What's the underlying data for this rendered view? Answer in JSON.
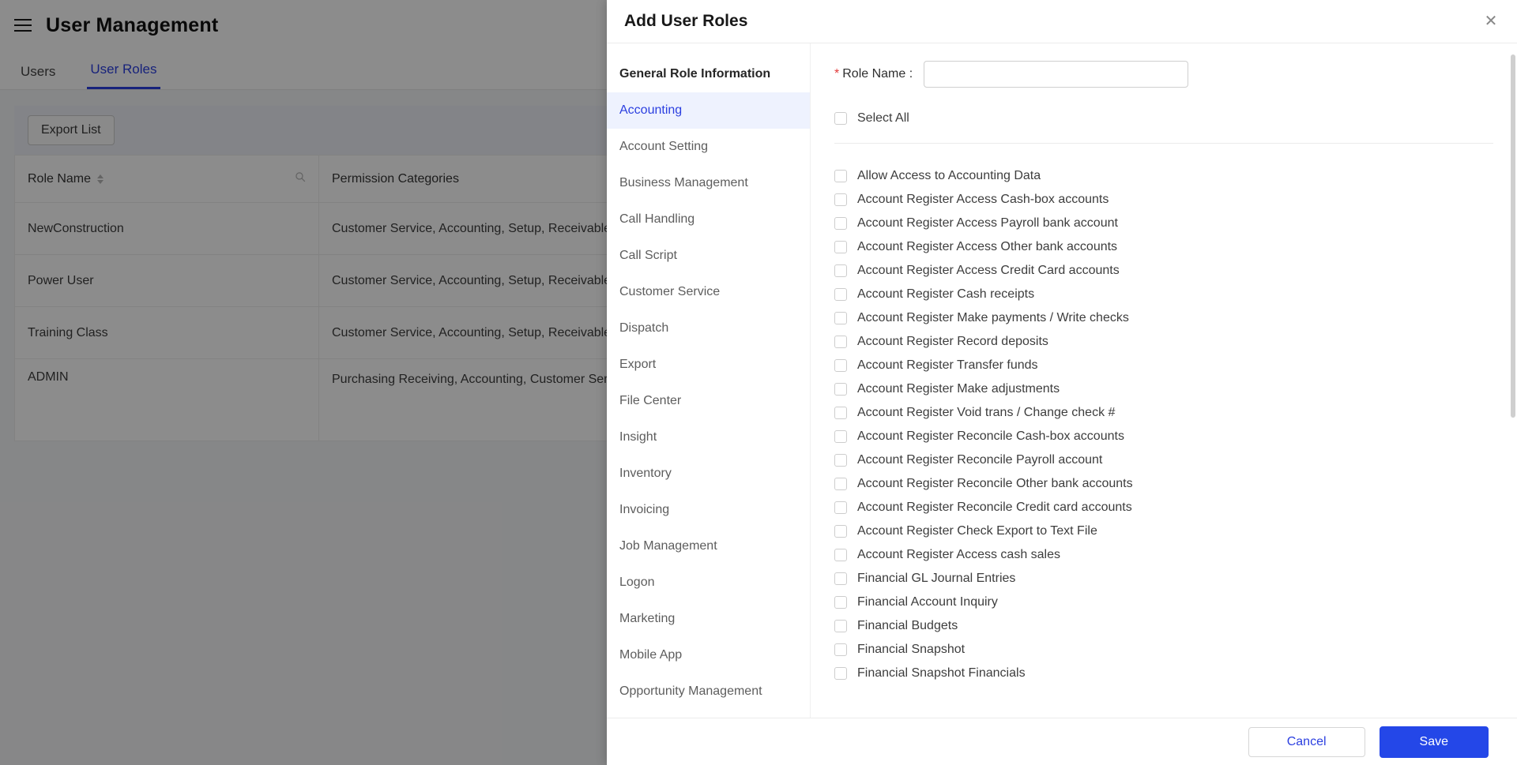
{
  "app": {
    "title": "User Management",
    "menu_icon": "hamburger-icon",
    "tabs": [
      {
        "label": "Users",
        "active": false
      },
      {
        "label": "User Roles",
        "active": true
      }
    ],
    "toolbar": {
      "export_label": "Export List"
    },
    "table": {
      "columns": [
        "Role Name",
        "Permission Categories"
      ],
      "search_icon": "search-icon",
      "rows": [
        {
          "role_name": "NewConstruction",
          "permissions": "Customer Service, Accounting, Setup, Receivables, Purch"
        },
        {
          "role_name": "Power User",
          "permissions": "Customer Service, Accounting, Setup, Receivables, Purch"
        },
        {
          "role_name": "Training Class",
          "permissions": "Customer Service, Accounting, Setup, Receivables, Purch"
        },
        {
          "role_name": "ADMIN",
          "permissions": "Purchasing Receiving, Accounting, Customer Service, Set Logon, Call Handling, Dispatch, Timecard, Product Catalo Management, Account Setting, Insight, Call Script, Job Ma"
        }
      ]
    }
  },
  "modal": {
    "title": "Add User Roles",
    "close_icon": "close-icon",
    "sidebar": {
      "heading": "General Role Information",
      "items": [
        {
          "label": "Accounting",
          "active": true
        },
        {
          "label": "Account Setting",
          "active": false
        },
        {
          "label": "Business Management",
          "active": false
        },
        {
          "label": "Call Handling",
          "active": false
        },
        {
          "label": "Call Script",
          "active": false
        },
        {
          "label": "Customer Service",
          "active": false
        },
        {
          "label": "Dispatch",
          "active": false
        },
        {
          "label": "Export",
          "active": false
        },
        {
          "label": "File Center",
          "active": false
        },
        {
          "label": "Insight",
          "active": false
        },
        {
          "label": "Inventory",
          "active": false
        },
        {
          "label": "Invoicing",
          "active": false
        },
        {
          "label": "Job Management",
          "active": false
        },
        {
          "label": "Logon",
          "active": false
        },
        {
          "label": "Marketing",
          "active": false
        },
        {
          "label": "Mobile App",
          "active": false
        },
        {
          "label": "Opportunity Management",
          "active": false
        }
      ]
    },
    "form": {
      "role_name_label": "Role Name :",
      "role_name_required_mark": "*",
      "role_name_value": "",
      "role_name_placeholder": ""
    },
    "select_all_label": "Select All",
    "permissions": [
      "Allow Access to Accounting Data",
      "Account Register Access Cash-box accounts",
      "Account Register Access Payroll bank account",
      "Account Register Access Other bank accounts",
      "Account Register Access Credit Card accounts",
      "Account Register Cash receipts",
      "Account Register Make payments / Write checks",
      "Account Register Record deposits",
      "Account Register Transfer funds",
      "Account Register Make adjustments",
      "Account Register Void trans / Change check #",
      "Account Register Reconcile Cash-box accounts",
      "Account Register Reconcile Payroll account",
      "Account Register Reconcile Other bank accounts",
      "Account Register Reconcile Credit card accounts",
      "Account Register Check Export to Text File",
      "Account Register Access cash sales",
      "Financial GL Journal Entries",
      "Financial Account Inquiry",
      "Financial Budgets",
      "Financial Snapshot",
      "Financial Snapshot Financials"
    ],
    "footer": {
      "cancel_label": "Cancel",
      "save_label": "Save"
    }
  },
  "colors": {
    "accent": "#2b3fe0",
    "save_button": "#2447e8",
    "required": "#e23b3b",
    "sidebar_active_bg": "#eef2fe"
  }
}
